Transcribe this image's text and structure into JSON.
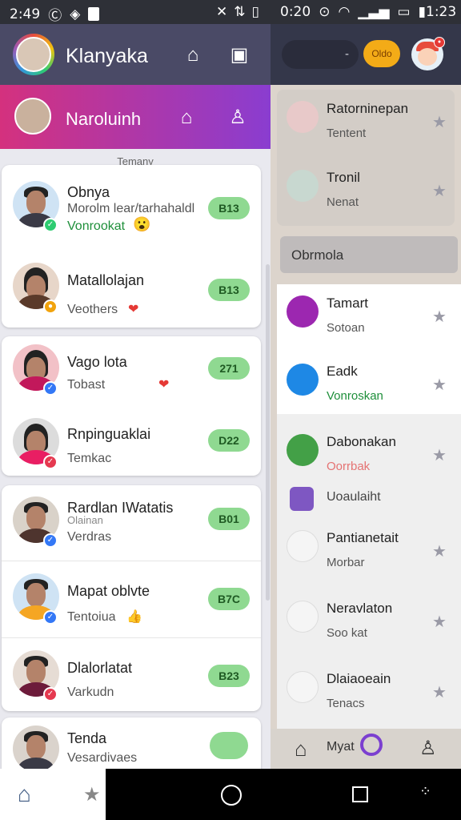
{
  "status_bar": {
    "left_time": "2:49",
    "right_time1": "0:20",
    "right_time2": "1:23"
  },
  "left_panel": {
    "app_title": "Klanyaka",
    "sub_title": "Naroluinh",
    "section_caption": "Temany",
    "cards": [
      {
        "rows": [
          {
            "name": "Obnya",
            "line1": "Morolm lear/tarhahaldl",
            "line2": "Vonrookat",
            "badge": "B13",
            "status_color": "#2ecc71"
          },
          {
            "name": "Matallolajan",
            "line1": "Veothers",
            "badge": "B13",
            "status_color": "#f1a30d"
          }
        ]
      },
      {
        "rows": [
          {
            "name": "Vago lota",
            "line1": "Tobast",
            "badge": "271",
            "status_color": "#3478f6"
          },
          {
            "name": "Rnpinguaklai",
            "line1": "Temkac",
            "badge": "D22",
            "status_color": "#e53950"
          }
        ]
      },
      {
        "rows": [
          {
            "name": "Rardlan IWatatis",
            "line0": "Olainan",
            "line1": "Verdras",
            "badge": "B01",
            "status_color": "#3478f6"
          },
          {
            "name": "Mapat oblvte",
            "line1": "Tentoiua",
            "badge": "B7C",
            "status_color": "#3478f6"
          },
          {
            "name": "Dlalorlatat",
            "line1": "Varkudn",
            "badge": "B23",
            "status_color": "#e53950"
          }
        ]
      },
      {
        "rows": [
          {
            "name": "Tenda",
            "line1": "Vesardivaes",
            "badge": "",
            "status_color": "#e53950"
          }
        ]
      }
    ]
  },
  "right_panel": {
    "header_pill": "-",
    "yellow_pill": "Oldo",
    "top_items": [
      {
        "name": "Ratorninepan",
        "sub": "Tentent"
      },
      {
        "name": "Tronil",
        "sub": "Nenat"
      }
    ],
    "search_label": "Obrmola",
    "list": [
      {
        "name": "Tamart",
        "sub": "Sotoan",
        "icon_color": "#9c27b0"
      },
      {
        "name": "Eadk",
        "sub": "Vonroskan",
        "icon_color": "#1e88e5",
        "sub_color": "#1e8f3a"
      },
      {
        "name": "Dabonakan",
        "sub": "Oorrbak",
        "icon_color": "#43a047",
        "sub_color": "#e57373"
      },
      {
        "name": "Uoaulaiht",
        "sub": "",
        "icon_color": "#7e57c2"
      },
      {
        "name": "Pantianetait",
        "sub": "Morbar",
        "icon_color": "#f5f5f5"
      },
      {
        "name": "Neravlaton",
        "sub": "Soo kat",
        "icon_color": "#f5f5f5"
      },
      {
        "name": "Dlaiaoeain",
        "sub": "Tenacs",
        "icon_color": "#f5f5f5"
      }
    ],
    "bottom_label": "Myat"
  }
}
